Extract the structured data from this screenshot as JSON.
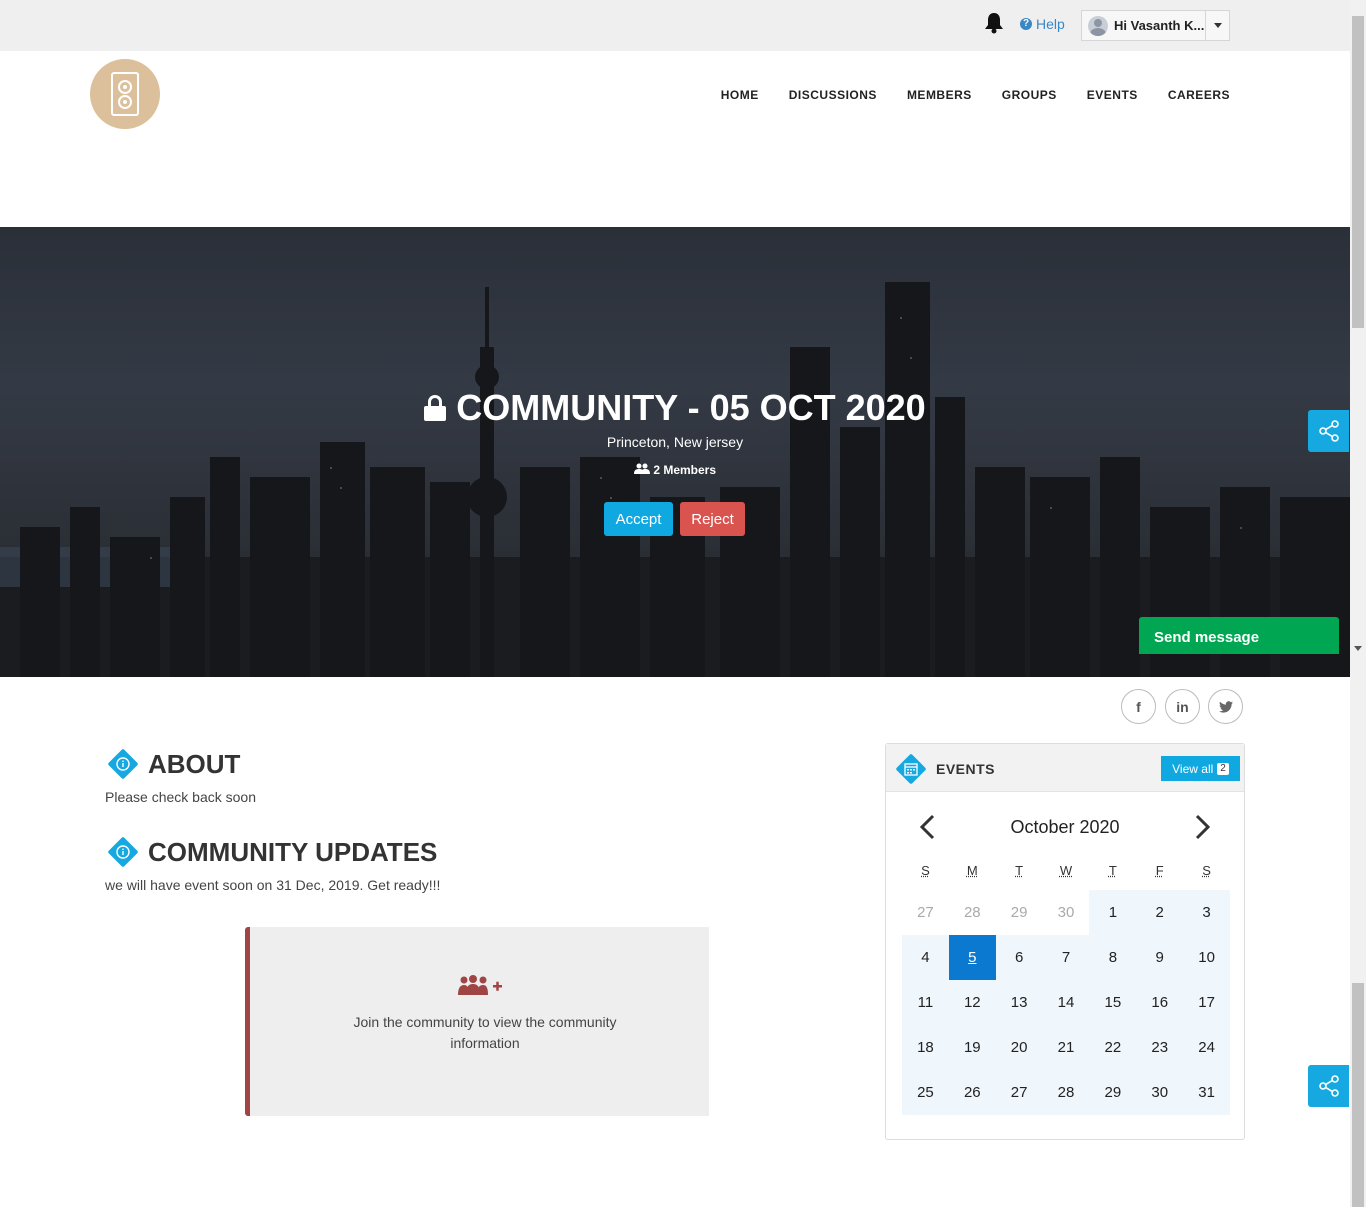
{
  "topbar": {
    "help_label": "Help",
    "help_icon": "?",
    "user_name": "Hi Vasanth K..."
  },
  "nav": {
    "items": [
      "HOME",
      "DISCUSSIONS",
      "MEMBERS",
      "GROUPS",
      "EVENTS",
      "CAREERS"
    ]
  },
  "hero": {
    "title": "COMMUNITY - 05 OCT 2020",
    "location": "Princeton, New jersey",
    "members": "2 Members",
    "accept_label": "Accept",
    "reject_label": "Reject",
    "send_message_label": "Send message"
  },
  "social": {
    "facebook": "f",
    "linkedin": "in",
    "twitter": "t"
  },
  "about": {
    "title": "ABOUT",
    "text": "Please check back soon"
  },
  "updates": {
    "title": "COMMUNITY UPDATES",
    "text": "we will have event soon on 31 Dec, 2019. Get ready!!!"
  },
  "join": {
    "text": "Join the community to view the community information"
  },
  "events": {
    "title": "EVENTS",
    "view_all_label": "View all",
    "count": "2",
    "calendar": {
      "month": "October 2020",
      "weekdays": [
        "S",
        "M",
        "T",
        "W",
        "T",
        "F",
        "S"
      ],
      "weeks": [
        [
          "27",
          "28",
          "29",
          "30",
          "1",
          "2",
          "3"
        ],
        [
          "4",
          "5",
          "6",
          "7",
          "8",
          "9",
          "10"
        ],
        [
          "11",
          "12",
          "13",
          "14",
          "15",
          "16",
          "17"
        ],
        [
          "18",
          "19",
          "20",
          "21",
          "22",
          "23",
          "24"
        ],
        [
          "25",
          "26",
          "27",
          "28",
          "29",
          "30",
          "31"
        ]
      ],
      "selected_day": "5"
    }
  },
  "colors": {
    "accent": "#10a8e0",
    "reject": "#d9534f",
    "send": "#00a651",
    "logo_bg": "#dcc09c",
    "join_border": "#a04545",
    "selected_day": "#0b79d0"
  },
  "icons": [
    "bell-icon",
    "help-icon",
    "user-avatar",
    "lock-icon",
    "members-icon",
    "share-icon",
    "info-icon",
    "calendar-icon",
    "add-group-icon",
    "chevron-left-icon",
    "chevron-right-icon"
  ]
}
